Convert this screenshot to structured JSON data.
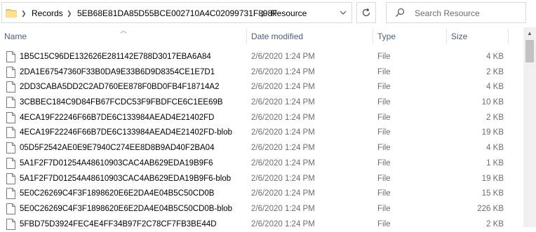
{
  "address": {
    "crumbs": [
      "Records",
      "5EB68E81DA85D55BCE002710A4C02099731F898F",
      "Resource"
    ]
  },
  "search": {
    "placeholder": "Search Resource"
  },
  "columns": {
    "name": "Name",
    "date": "Date modified",
    "type": "Type",
    "size": "Size"
  },
  "files": [
    {
      "name": "1B5C15C96DE132626E281142E788D3017EBA6A84",
      "date": "2/6/2020 1:24 PM",
      "type": "File",
      "size": "4 KB"
    },
    {
      "name": "2DA1E67547360F33B0DA9E33B6D9D8354CE1E7D1",
      "date": "2/6/2020 1:24 PM",
      "type": "File",
      "size": "2 KB"
    },
    {
      "name": "2DD3CABA5DD2C2AD760EE878F0BD0FB4F18714A2",
      "date": "2/6/2020 1:24 PM",
      "type": "File",
      "size": "4 KB"
    },
    {
      "name": "3CBBEC184C9D84FB67FCDC53F9FBDFCE6C1EE69B",
      "date": "2/6/2020 1:24 PM",
      "type": "File",
      "size": "10 KB"
    },
    {
      "name": "4ECA19F22246F66B7DE6C133984AEAD4E21402FD",
      "date": "2/6/2020 1:24 PM",
      "type": "File",
      "size": "2 KB"
    },
    {
      "name": "4ECA19F22246F66B7DE6C133984AEAD4E21402FD-blob",
      "date": "2/6/2020 1:24 PM",
      "type": "File",
      "size": "19 KB"
    },
    {
      "name": "05D5F2542AE0E9E7940C274EE8D8B9AD40F2BA04",
      "date": "2/6/2020 1:24 PM",
      "type": "File",
      "size": "4 KB"
    },
    {
      "name": "5A1F2F7D01254A48610903CAC4AB629EDA19B9F6",
      "date": "2/6/2020 1:24 PM",
      "type": "File",
      "size": "1 KB"
    },
    {
      "name": "5A1F2F7D01254A48610903CAC4AB629EDA19B9F6-blob",
      "date": "2/6/2020 1:24 PM",
      "type": "File",
      "size": "19 KB"
    },
    {
      "name": "5E0C26269C4F3F1898620E6E2DA4E04B5C50CD0B",
      "date": "2/6/2020 1:24 PM",
      "type": "File",
      "size": "15 KB"
    },
    {
      "name": "5E0C26269C4F3F1898620E6E2DA4E04B5C50CD0B-blob",
      "date": "2/6/2020 1:24 PM",
      "type": "File",
      "size": "226 KB"
    },
    {
      "name": "5FBD75D3924FEC4E4FF34B97F2C78CF7FB3BE44D",
      "date": "2/6/2020 1:24 PM",
      "type": "File",
      "size": "2 KB"
    }
  ]
}
